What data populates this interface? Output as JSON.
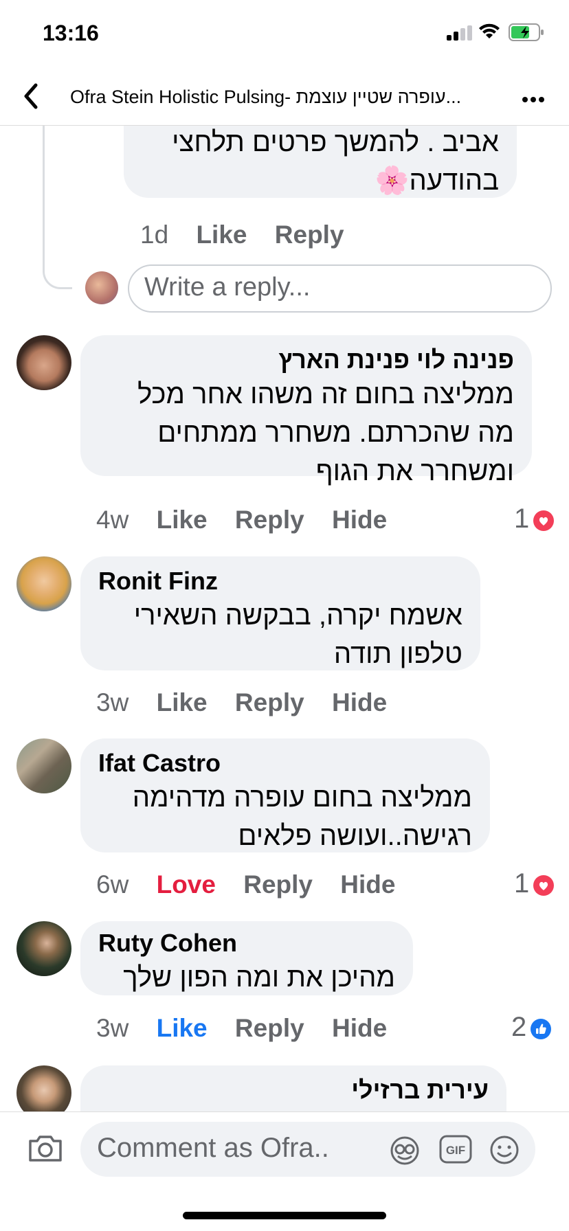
{
  "status_bar": {
    "time": "13:16"
  },
  "header": {
    "title": "Ofra Stein Holistic Pulsing- עופרה שטיין עוצמת..."
  },
  "top_comment": {
    "text": "אביב . להמשך פרטים תלחצי\nבהודעה🌸",
    "age": "1d",
    "like": "Like",
    "reply": "Reply"
  },
  "reply_input": {
    "placeholder": "Write a reply..."
  },
  "comments": [
    {
      "name": "פנינה לוי פנינת הארץ",
      "text": "ממליצה בחום זה משהו אחר מכל\nמה שהכרתם. משחרר ממתחים\nומשחרר את הגוף",
      "age": "4w",
      "like": "Like",
      "reply": "Reply",
      "hide": "Hide",
      "reactions": "1"
    },
    {
      "name": "Ronit Finz",
      "text": "אשמח יקרה, בבקשה השאירי\nטלפון תודה",
      "age": "3w",
      "like": "Like",
      "reply": "Reply",
      "hide": "Hide"
    },
    {
      "name": "Ifat Castro",
      "text": "ממליצה בחום עופרה מדהימה\nרגישה..ועושה פלאים",
      "age": "6w",
      "like": "Love",
      "reply": "Reply",
      "hide": "Hide",
      "reactions": "1"
    },
    {
      "name": "Ruty Cohen",
      "text": "מהיכן את ומה הפון שלך",
      "age": "3w",
      "like": "Like",
      "reply": "Reply",
      "hide": "Hide",
      "reactions": "2"
    },
    {
      "name": "עירית ברזילי"
    }
  ],
  "composer": {
    "placeholder": "Comment as Ofra..."
  },
  "colors": {
    "accent": "#1877f2",
    "love": "#e41e3f",
    "bubble": "#f0f2f5",
    "meta": "#65676b"
  },
  "icons": [
    "back-chevron-icon",
    "more-icon",
    "heart-reaction-icon",
    "like-reaction-icon",
    "camera-icon",
    "avatar-sticker-icon",
    "gif-icon",
    "emoji-icon"
  ]
}
